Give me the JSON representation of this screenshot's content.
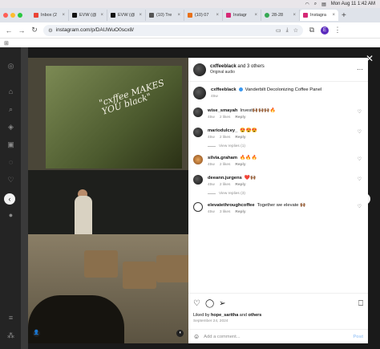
{
  "menubar": {
    "datetime": "Mon Aug 11  1:42 AM",
    "icons": [
      "wifi-icon",
      "search-icon",
      "control-center-icon"
    ]
  },
  "tabs": [
    {
      "label": "Inbox (2",
      "color": "#ea4335"
    },
    {
      "label": "EVW (@",
      "color": "#111111"
    },
    {
      "label": "EVW (@",
      "color": "#111111"
    },
    {
      "label": "(10) Tre",
      "color": "#555555"
    },
    {
      "label": "(10) 07",
      "color": "#e8711a"
    },
    {
      "label": "Instagr",
      "color": "#d62976"
    },
    {
      "label": "28-28",
      "color": "#34a853"
    },
    {
      "label": "Instagra",
      "color": "#d62976",
      "active": true
    }
  ],
  "address": {
    "url": "instagram.com/p/DAUWuO0scx8/",
    "profile_initial": "E"
  },
  "post": {
    "author": "cxffeeblack",
    "coauthors": "and 3 others",
    "audio": "Original audio",
    "screen_text": "\"cxffee MAKES YOU black\"",
    "caption_user": "cxffeeblack",
    "caption": "Vanderbilt Decolonizing Coffee Panel",
    "caption_age": "45w",
    "liked_by_prefix": "Liked by",
    "liked_by_user": "hope_saritha",
    "liked_by_suffix": "and",
    "liked_by_others": "others",
    "date": "September 24, 2024",
    "add_comment_placeholder": "Add a comment...",
    "post_label": "Post"
  },
  "comments": [
    {
      "user": "wise_smayah",
      "text": "Invest🙌🏾🙌🏾🙌🏾🔥",
      "age": "45w",
      "likes": "2 likes",
      "reply": "Reply",
      "view_replies": ""
    },
    {
      "user": "mariodulcey_",
      "text": "😍😍😍",
      "age": "45w",
      "likes": "2 likes",
      "reply": "Reply",
      "view_replies": "View replies (1)"
    },
    {
      "user": "silvia.graham",
      "text": "🔥🔥🔥",
      "age": "45w",
      "likes": "2 likes",
      "reply": "Reply",
      "view_replies": ""
    },
    {
      "user": "deeann.jurgens",
      "text": "❤️🙌🏾",
      "age": "45w",
      "likes": "2 likes",
      "reply": "Reply",
      "view_replies": "View replies (3)"
    },
    {
      "user": "elevatethroughcoffee",
      "text": "Together we elevate 🙌🏾",
      "age": "45w",
      "likes": "3 likes",
      "reply": "Reply",
      "view_replies": ""
    }
  ]
}
